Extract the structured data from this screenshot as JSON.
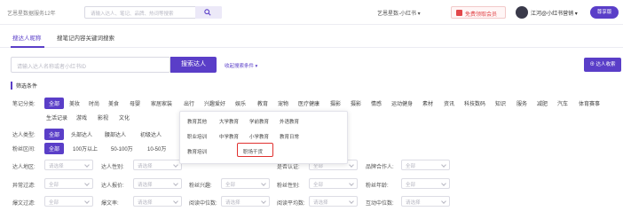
{
  "topbar": {
    "slogan": "艺恩星数据服务12年",
    "search_placeholder": "请输入达人、笔记、品牌、热词等搜索",
    "account_select": "艺恩星数-小红书",
    "coupon_label": "免费领取会员",
    "user_name": "江河@小红书营销",
    "vip_label": "尊享版"
  },
  "tabs": [
    {
      "label": "搜达人昵称"
    },
    {
      "label": "搜笔记内容关键词搜索"
    }
  ],
  "search": {
    "placeholder": "请输入达人名称或者小红书ID",
    "button": "搜索达人",
    "advanced": "收起搜索条件",
    "add": "达人收索"
  },
  "filter_title": "筛选条件",
  "category": {
    "label": "笔记分类:",
    "row1": [
      "全部",
      "美妆",
      "时尚",
      "美食",
      "母婴",
      "家居家装",
      "出行",
      "兴趣爱好",
      "娱乐",
      "教育",
      "宠物",
      "医疗健康",
      "摄影",
      "摄影",
      "情感",
      "运动健身",
      "素材",
      "资讯",
      "科技数码",
      "知识",
      "服务",
      "减肥",
      "汽车",
      "体育赛事"
    ],
    "row2": [
      "生活记录",
      "游戏",
      "影视",
      "文化"
    ]
  },
  "influencer_type": {
    "label": "达人类型:",
    "options": [
      "全部",
      "头部达人",
      "腰部达人",
      "初级达人",
      "素人"
    ]
  },
  "fans_range": {
    "label": "粉丝区间:",
    "options": [
      "全部",
      "100万以上",
      "50-100万",
      "10-50万"
    ]
  },
  "dropdown": {
    "items": [
      "教育其他",
      "大学教育",
      "学前教育",
      "外语教育",
      "职业培训",
      "中学教育",
      "小学教育",
      "教育日常",
      "教育培训",
      "职场干货"
    ],
    "highlighted": "职场干货"
  },
  "filters": {
    "row1": [
      {
        "label": "达人地区:",
        "value": "请选择"
      },
      {
        "label": "达人性别:",
        "value": "请选择"
      },
      {
        "label": "是否认证:",
        "value": "全部"
      },
      {
        "label": "品牌合作人:",
        "value": "全部"
      }
    ],
    "row2": [
      {
        "label": "异常过滤:",
        "value": "全部"
      },
      {
        "label": "达人报价:",
        "value": "请选择"
      },
      {
        "label": "粉丝兴趣:",
        "value": "全部"
      },
      {
        "label": "粉丝性别:",
        "value": "全部"
      },
      {
        "label": "粉丝年龄:",
        "value": "全部"
      }
    ],
    "row3": [
      {
        "label": "爆文过滤:",
        "value": "全部"
      },
      {
        "label": "爆文率:",
        "value": "请选择"
      },
      {
        "label": "阅读中位数:",
        "value": "请选择"
      },
      {
        "label": "阅读平均数:",
        "value": "请选择"
      },
      {
        "label": "互动中位数:",
        "value": "请选择"
      }
    ]
  },
  "colors": {
    "accent": "#5a3ec8",
    "highlight": "#e0312f"
  }
}
